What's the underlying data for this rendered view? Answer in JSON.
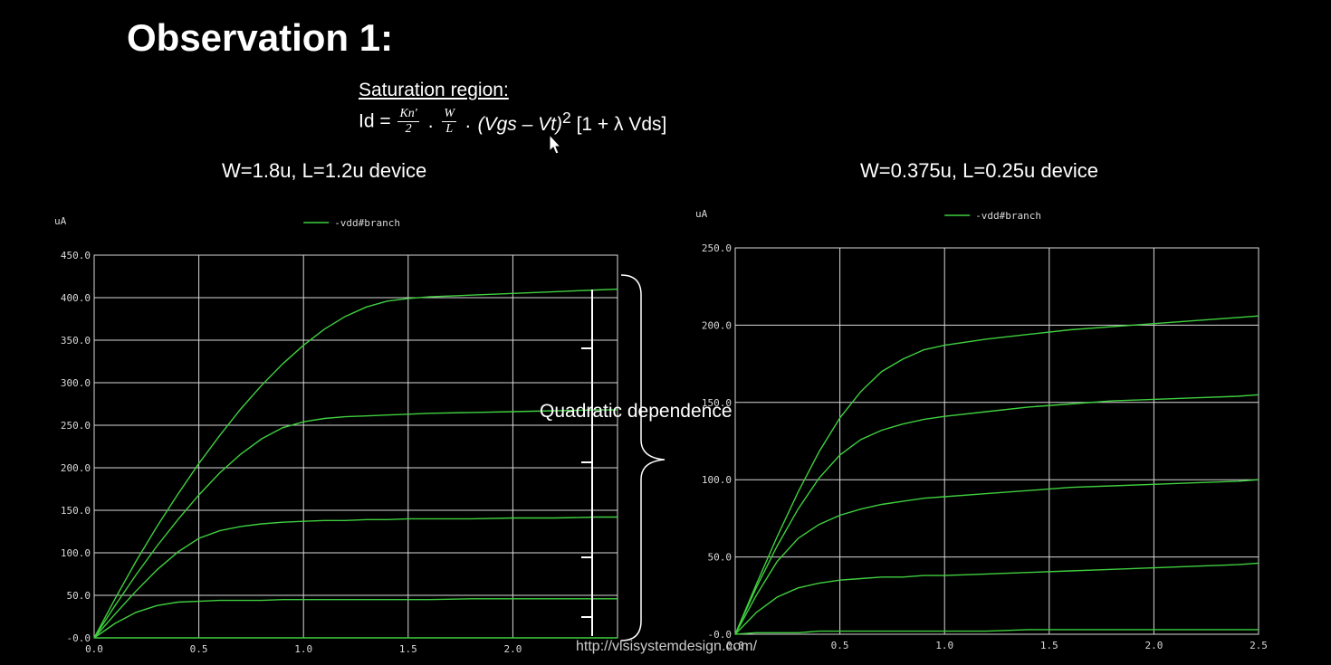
{
  "page": {
    "title": "Observation 1:",
    "formula_heading": "Saturation region:",
    "formula": {
      "lhs": "Id =",
      "frac1_num": "Kn′",
      "frac1_den": "2",
      "frac2_num": "W",
      "frac2_den": "L",
      "dot": ".",
      "rhs_var": "(Vgs – Vt)",
      "rhs_exp": "2",
      "rhs_tail": "[1 + λ Vds]"
    },
    "annotation": "Quadratic dependence",
    "watermark": "http://vlsisystemdesign.com/"
  },
  "colors": {
    "background": "#000000",
    "grid": "#d8d8d8",
    "curve": "#3fcf3f",
    "text": "#ffffff"
  },
  "chart_data": [
    {
      "type": "line",
      "title": "W=1.8u, L=1.2u device",
      "ylabel": "uA",
      "legend": "-vdd#branch",
      "legend_position": "top-center",
      "xlim": [
        0,
        2.5
      ],
      "ylim": [
        0,
        450
      ],
      "grid": true,
      "xticks": [
        "0.0",
        "0.5",
        "1.0",
        "1.5",
        "2.0"
      ],
      "yticks": [
        "-0.0",
        "50.0",
        "100.0",
        "150.0",
        "200.0",
        "250.0",
        "300.0",
        "350.0",
        "400.0",
        "450.0"
      ],
      "x": [
        0,
        0.1,
        0.2,
        0.3,
        0.4,
        0.5,
        0.6,
        0.7,
        0.8,
        0.9,
        1.0,
        1.1,
        1.2,
        1.3,
        1.4,
        1.5,
        1.6,
        1.8,
        2.0,
        2.2,
        2.4,
        2.5
      ],
      "series": [
        {
          "values": [
            0,
            46,
            90,
            131,
            169,
            205,
            238,
            269,
            297,
            322,
            344,
            363,
            378,
            389,
            396,
            399,
            401,
            403,
            405,
            407,
            409,
            410
          ]
        },
        {
          "values": [
            0,
            38,
            74,
            108,
            139,
            168,
            194,
            216,
            234,
            247,
            254,
            258,
            260,
            261,
            262,
            263,
            264,
            265,
            266,
            267,
            268,
            268
          ]
        },
        {
          "values": [
            0,
            28,
            55,
            80,
            101,
            117,
            126,
            131,
            134,
            136,
            137,
            138,
            138,
            139,
            139,
            140,
            140,
            140,
            141,
            141,
            142,
            142
          ]
        },
        {
          "values": [
            0,
            17,
            30,
            38,
            42,
            43,
            44,
            44,
            44,
            45,
            45,
            45,
            45,
            45,
            45,
            45,
            45,
            46,
            46,
            46,
            46,
            46
          ]
        },
        {
          "values": [
            0,
            0,
            0,
            0,
            0,
            0,
            0,
            0,
            0,
            0,
            0,
            0,
            0,
            0,
            0,
            0,
            0,
            0,
            0,
            0,
            0,
            0
          ]
        }
      ]
    },
    {
      "type": "line",
      "title": "W=0.375u, L=0.25u device",
      "ylabel": "uA",
      "legend": "-vdd#branch",
      "legend_position": "top-center",
      "xlim": [
        0,
        2.5
      ],
      "ylim": [
        0,
        250
      ],
      "grid": true,
      "xticks": [
        "0.0",
        "0.5",
        "1.0",
        "1.5",
        "2.0",
        "2.5"
      ],
      "yticks": [
        "-0.0",
        "50.0",
        "100.0",
        "150.0",
        "200.0",
        "250.0"
      ],
      "x": [
        0,
        0.1,
        0.2,
        0.3,
        0.4,
        0.5,
        0.6,
        0.7,
        0.8,
        0.9,
        1.0,
        1.2,
        1.4,
        1.6,
        1.8,
        2.0,
        2.2,
        2.4,
        2.5
      ],
      "series": [
        {
          "values": [
            0,
            32,
            63,
            92,
            118,
            140,
            157,
            170,
            178,
            184,
            187,
            191,
            194,
            197,
            199,
            201,
            203,
            205,
            206
          ]
        },
        {
          "values": [
            0,
            30,
            57,
            81,
            101,
            116,
            126,
            132,
            136,
            139,
            141,
            144,
            147,
            149,
            151,
            152,
            153,
            154,
            155
          ]
        },
        {
          "values": [
            0,
            25,
            47,
            62,
            71,
            77,
            81,
            84,
            86,
            88,
            89,
            91,
            93,
            95,
            96,
            97,
            98,
            99,
            100
          ]
        },
        {
          "values": [
            0,
            14,
            24,
            30,
            33,
            35,
            36,
            37,
            37,
            38,
            38,
            39,
            40,
            41,
            42,
            43,
            44,
            45,
            46
          ]
        },
        {
          "values": [
            0,
            1,
            1,
            1,
            2,
            2,
            2,
            2,
            2,
            2,
            2,
            2,
            3,
            3,
            3,
            3,
            3,
            3,
            3
          ]
        }
      ]
    }
  ]
}
